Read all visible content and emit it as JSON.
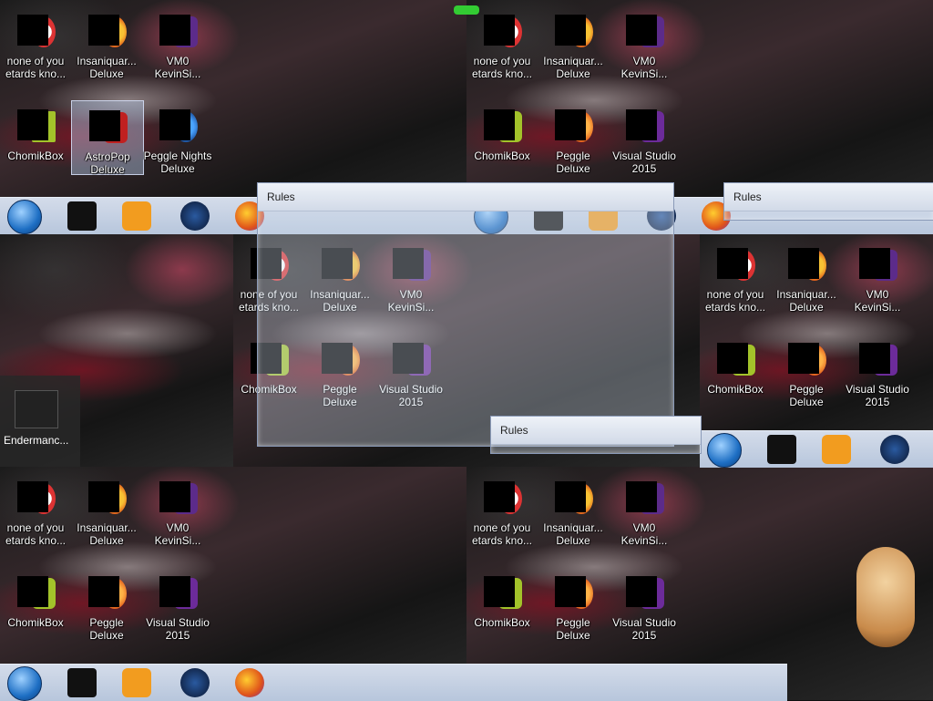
{
  "desktop_icons": {
    "row1": [
      {
        "name": "none-of-you",
        "label1": "none of you",
        "label2": "etards kno..."
      },
      {
        "name": "insaniquarium",
        "label1": "Insaniquar...",
        "label2": "Deluxe"
      },
      {
        "name": "vm0",
        "label1": "VM0",
        "label2": "KevinSi..."
      }
    ],
    "row2": [
      {
        "name": "chomikbox",
        "label1": "ChomikBox",
        "label2": ""
      },
      {
        "name": "astropop",
        "label1": "AstroPop",
        "label2": "Deluxe"
      },
      {
        "name": "peggle-nights",
        "label1": "Peggle Nights",
        "label2": "Deluxe"
      }
    ],
    "row2b": [
      {
        "name": "chomikbox",
        "label1": "ChomikBox",
        "label2": ""
      },
      {
        "name": "peggle-deluxe",
        "label1": "Peggle Deluxe",
        "label2": ""
      },
      {
        "name": "visual-studio",
        "label1": "Visual Studio",
        "label2": "2015"
      }
    ]
  },
  "window": {
    "title": "Rules"
  },
  "side_item": {
    "label": "Endermanc..."
  },
  "colors": {
    "taskbar": "#c5d2e6",
    "selected": "#b4c8e6",
    "vs_purple": "#6c2b9a"
  }
}
